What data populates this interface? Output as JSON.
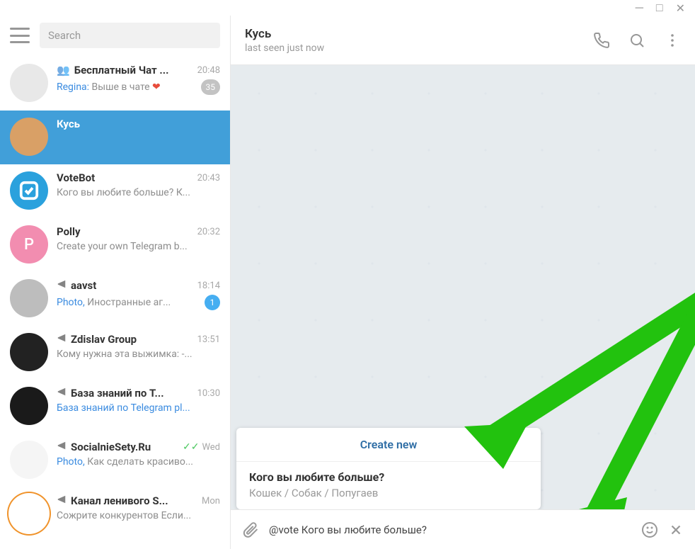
{
  "search": {
    "placeholder": "Search"
  },
  "header": {
    "title": "Кусь",
    "status": "last seen just now"
  },
  "chats": [
    {
      "name": "Бесплатный Чат ...",
      "time": "20:48",
      "sender": "Regina:",
      "preview": " Выше в чате ",
      "heart": true,
      "badge": "35",
      "badgeBlue": false,
      "group": true,
      "avatarBg": "#e8e8e8",
      "avatarText": ""
    },
    {
      "name": "Кусь",
      "time": "",
      "preview": "",
      "active": true,
      "avatarBg": "#d9a066",
      "avatarText": ""
    },
    {
      "name": "VoteBot",
      "time": "20:43",
      "preview": "Кого вы любите больше?  К...",
      "avatarBg": "#2aa1dd",
      "avatarText": "",
      "checkbox": true
    },
    {
      "name": "Polly",
      "time": "20:32",
      "preview": "Create your own Telegram b...",
      "avatarBg": "#f28db0",
      "avatarText": "P"
    },
    {
      "name": "aavst",
      "time": "18:14",
      "preview": "Иностранные аг...",
      "prefix": "Photo, ",
      "channel": true,
      "badge": "1",
      "badgeBlue": true,
      "avatarBg": "#bdbdbd",
      "avatarText": ""
    },
    {
      "name": "Zdislav Group",
      "time": "13:51",
      "preview": "Кому нужна эта выжимка:  -...",
      "channel": true,
      "avatarBg": "#222",
      "avatarText": ""
    },
    {
      "name": "База знаний по T...",
      "time": "10:30",
      "previewHL": "База знаний по Telegram pl...",
      "channel": true,
      "avatarBg": "#1a1a1a",
      "avatarText": ""
    },
    {
      "name": "SocialnieSety.Ru",
      "time": "Wed",
      "preview": "Как сделать красиво...",
      "prefix": "Photo, ",
      "channel": true,
      "checks": true,
      "avatarBg": "#f5f5f5",
      "avatarText": ""
    },
    {
      "name": "Канал ленивого S...",
      "time": "Mon",
      "preview": "Сожрите конкурентов  Если...",
      "channel": true,
      "avatarBg": "#fff",
      "avatarText": "",
      "ring": true
    }
  ],
  "popup": {
    "create": "Create new",
    "question": "Кого вы любите больше?",
    "answers": "Кошек / Собак / Попугаев"
  },
  "input": {
    "text": "@vote Кого вы любите больше?"
  },
  "icons": {
    "phone": "phone",
    "search": "search",
    "more": "more",
    "emoji": "emoji",
    "close": "close",
    "attach": "attach"
  }
}
